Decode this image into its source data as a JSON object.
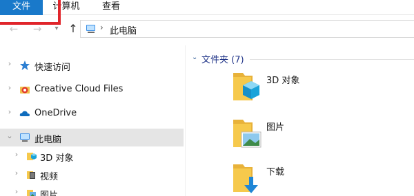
{
  "ribbon": {
    "tabs": [
      {
        "label": "文件",
        "active": true
      },
      {
        "label": "计算机",
        "active": false
      },
      {
        "label": "查看",
        "active": false
      }
    ]
  },
  "address_bar": {
    "separator": "›",
    "path": "此电脑"
  },
  "nav_buttons": {
    "back_icon": "arrow-left-icon",
    "forward_icon": "arrow-right-icon",
    "recent_icon": "chevron-down-icon",
    "up_icon": "arrow-up-icon"
  },
  "navigation_pane": {
    "items": [
      {
        "label": "快速访问",
        "icon": "star-icon",
        "level": 0,
        "selected": false
      },
      {
        "label": "Creative Cloud Files",
        "icon": "creative-cloud-icon",
        "level": 0,
        "selected": false
      },
      {
        "label": "OneDrive",
        "icon": "cloud-icon",
        "level": 0,
        "selected": false
      },
      {
        "label": "此电脑",
        "icon": "computer-icon",
        "level": 0,
        "selected": true,
        "expanded": true
      },
      {
        "label": "3D 对象",
        "icon": "3d-objects-folder-icon",
        "level": 1,
        "selected": false
      },
      {
        "label": "视频",
        "icon": "video-folder-icon",
        "level": 1,
        "selected": false
      },
      {
        "label": "图片",
        "icon": "pictures-folder-icon",
        "level": 1,
        "selected": false
      }
    ]
  },
  "content": {
    "group_title": "文件夹 (7)",
    "folders": [
      {
        "label": "3D 对象",
        "icon": "3d-objects-folder-icon"
      },
      {
        "label": "图片",
        "icon": "pictures-folder-icon"
      },
      {
        "label": "下载",
        "icon": "downloads-folder-icon"
      }
    ]
  },
  "colors": {
    "accent": "#1979ca",
    "highlight_box": "#e0252b",
    "folder_yellow": "#f6c94c",
    "selection": "#e5e5e5"
  }
}
